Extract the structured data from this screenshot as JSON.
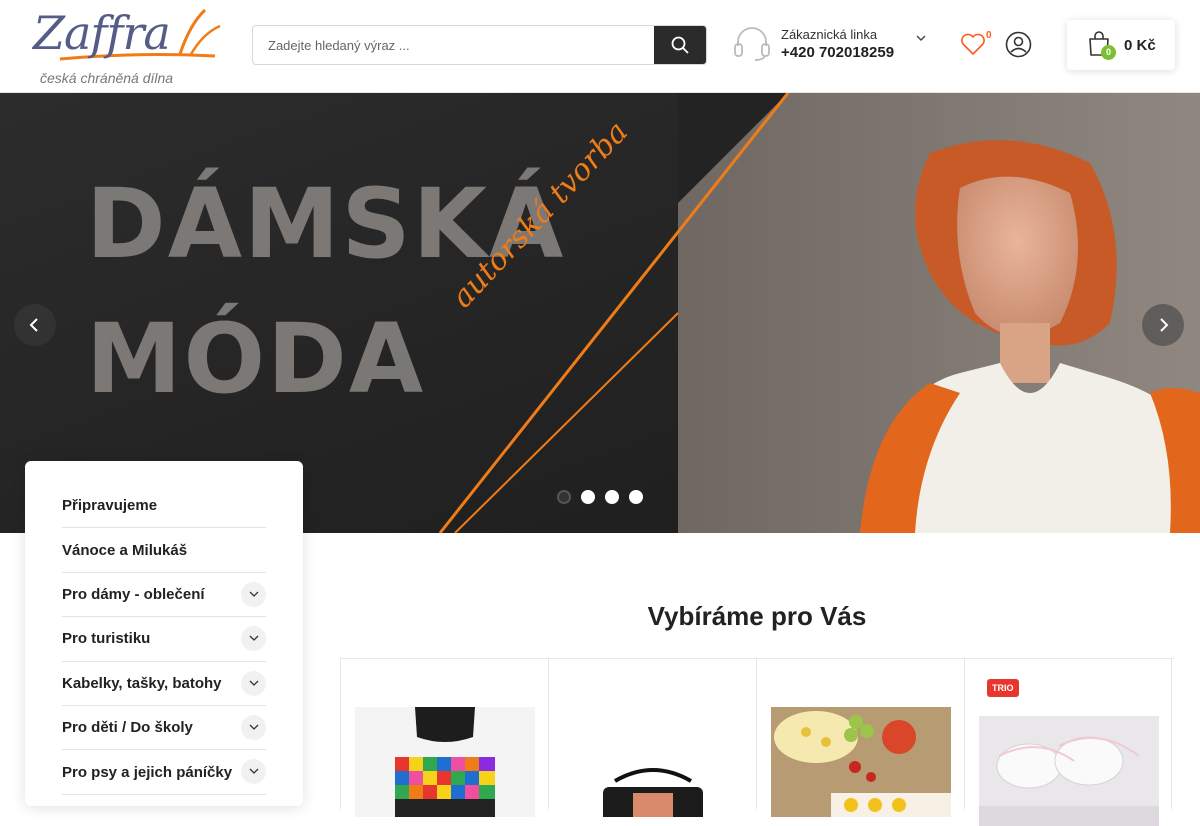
{
  "header": {
    "logo_text": "Zaffra",
    "tagline": "česká chráněná dílna",
    "search_placeholder": "Zadejte hledaný výraz ...",
    "hotline_label": "Zákaznická linka",
    "hotline_phone": "+420 702018259",
    "wishlist_count": "0",
    "cart_count": "0",
    "cart_total": "0 Kč",
    "icons": [
      "search-icon",
      "headset-icon",
      "chevron-down-icon",
      "heart-icon",
      "user-icon",
      "shopping-bag-icon"
    ]
  },
  "hero": {
    "headline_1": "DÁMSKÁ",
    "headline_2": "MÓDA",
    "script": "autorská tvorba",
    "slides": 4,
    "active_slide": 1,
    "accent_color": "#f07c18"
  },
  "categories": [
    {
      "label": "Připravujeme",
      "expandable": false
    },
    {
      "label": "Vánoce a Milukáš",
      "expandable": false
    },
    {
      "label": "Pro dámy - oblečení",
      "expandable": true
    },
    {
      "label": "Pro turistiku",
      "expandable": true
    },
    {
      "label": "Kabelky, tašky, batohy",
      "expandable": true
    },
    {
      "label": "Pro děti / Do školy",
      "expandable": true
    },
    {
      "label": "Pro psy a jejich páníčky",
      "expandable": true
    }
  ],
  "featured": {
    "title": "Vybíráme pro Vás",
    "products": [
      {
        "badge": ""
      },
      {
        "badge": ""
      },
      {
        "badge": ""
      },
      {
        "badge": "TRIO"
      }
    ]
  }
}
